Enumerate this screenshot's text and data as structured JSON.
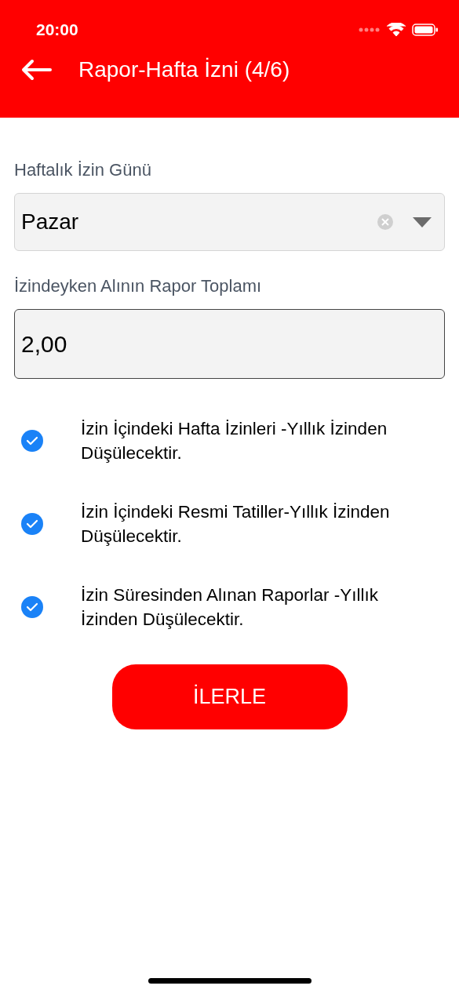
{
  "status_bar": {
    "time": "20:00"
  },
  "header": {
    "title": "Rapor-Hafta İzni (4/6)"
  },
  "day_field": {
    "label": "Haftalık İzin Günü",
    "value": "Pazar"
  },
  "report_field": {
    "label": "İzindeyken Alının Rapor Toplamı",
    "value": "2,00"
  },
  "checks": [
    {
      "label": "İzin İçindeki Hafta İzinleri -Yıllık İzinden Düşülecektir.",
      "checked": true
    },
    {
      "label": "İzin İçindeki Resmi Tatiller-Yıllık İzinden Düşülecektir.",
      "checked": true
    },
    {
      "label": "İzin Süresinden Alınan Raporlar -Yıllık İzinden Düşülecektir.",
      "checked": true
    }
  ],
  "next_button": {
    "label": "İLERLE"
  }
}
